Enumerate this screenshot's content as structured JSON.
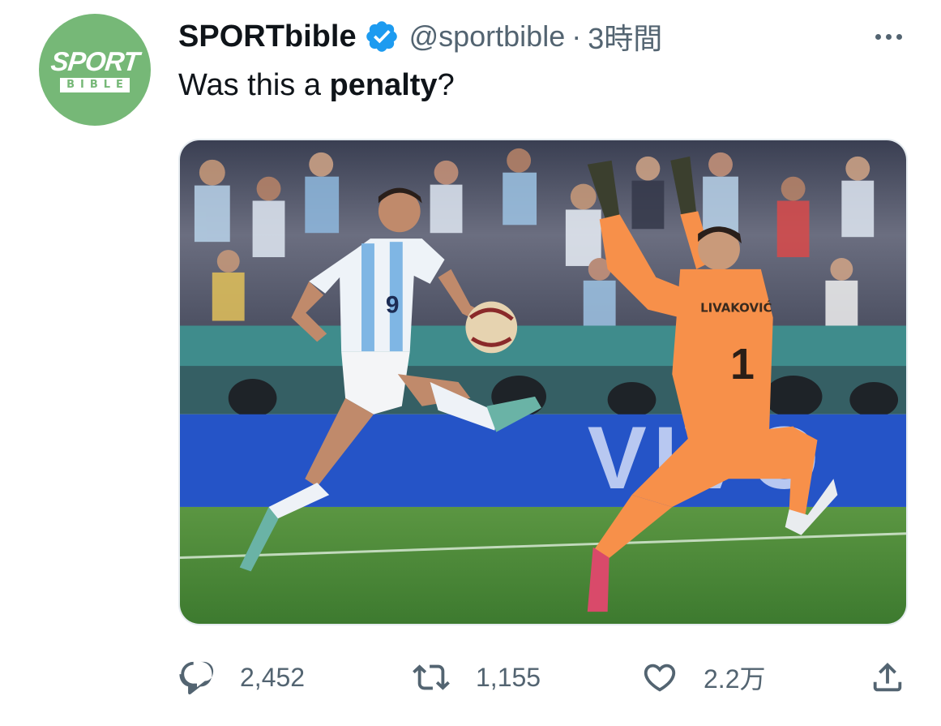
{
  "account": {
    "avatar_text_top": "SPORT",
    "avatar_text_bottom": "BIBLE",
    "display_name": "SPORTbible",
    "handle": "@sportbible",
    "separator": "·",
    "time": "3時間",
    "verified": true
  },
  "tweet": {
    "text_before": "Was this a ",
    "text_bold": "penalty",
    "text_after": "?"
  },
  "media": {
    "type": "photo",
    "jersey_name": "LIVAKOVIĆ",
    "jersey_number_keeper": "1",
    "jersey_number_striker": "9",
    "board_text": "VIVO"
  },
  "actions": {
    "reply_count": "2,452",
    "retweet_count": "1,155",
    "like_count": "2.2万"
  },
  "colors": {
    "brand_green": "#76b877",
    "verified_blue": "#1d9bf0",
    "secondary_text": "#536471",
    "keeper_kit": "#f7904a",
    "pitch_green": "#4f8a3a"
  },
  "icons": [
    "more-icon",
    "verified-badge-icon",
    "reply-icon",
    "retweet-icon",
    "like-icon",
    "share-icon"
  ]
}
